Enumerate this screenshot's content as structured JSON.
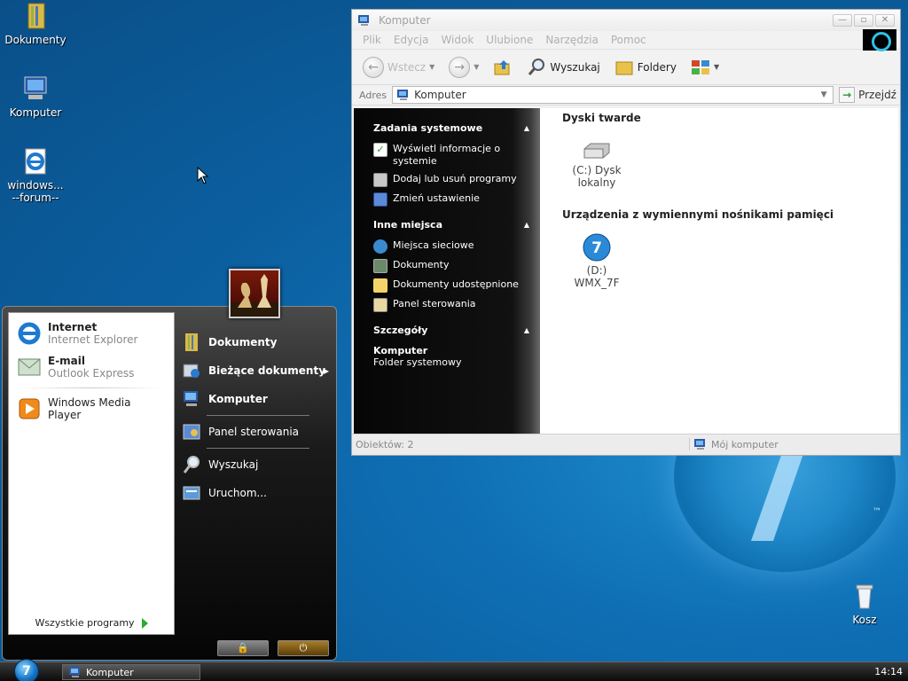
{
  "desktop": {
    "icons": [
      {
        "label": "Dokumenty"
      },
      {
        "label": "Komputer"
      },
      {
        "label": "windows...\n--forum--"
      },
      {
        "label": "Kosz"
      }
    ],
    "trademark": "™"
  },
  "window": {
    "title": "Komputer",
    "buttons": {
      "minimize": "—",
      "restore": "▫",
      "close": "✕"
    },
    "menu": [
      "Plik",
      "Edycja",
      "Widok",
      "Ulubione",
      "Narzędzia",
      "Pomoc"
    ],
    "toolbar": {
      "back": "Wstecz",
      "search": "Wyszukaj",
      "folders": "Foldery"
    },
    "address": {
      "label": "Adres",
      "value": "Komputer",
      "go": "Przejdź"
    },
    "taskpane": {
      "sections": [
        {
          "title": "Zadania systemowe",
          "items": [
            "Wyświetl informacje o systemie",
            "Dodaj lub usuń programy",
            "Zmień ustawienie"
          ]
        },
        {
          "title": "Inne miejsca",
          "items": [
            "Miejsca sieciowe",
            "Dokumenty",
            "Dokumenty udostępnione",
            "Panel sterowania"
          ]
        },
        {
          "title": "Szczegóły",
          "name": "Komputer",
          "type": "Folder systemowy"
        }
      ]
    },
    "groups": [
      {
        "title": "Dyski twarde",
        "items": [
          {
            "line1": "(C:) Dysk",
            "line2": "lokalny"
          }
        ]
      },
      {
        "title": "Urządzenia z wymiennymi nośnikami pamięci",
        "items": [
          {
            "line1": "(D:)",
            "line2": "WMX_7F",
            "badge": "7"
          }
        ]
      }
    ],
    "status": {
      "left": "Obiektów: 2",
      "right": "Mój komputer"
    }
  },
  "start_menu": {
    "pinned": [
      {
        "title": "Internet",
        "subtitle": "Internet Explorer"
      },
      {
        "title": "E-mail",
        "subtitle": "Outlook Express"
      }
    ],
    "recent": [
      "Windows Media Player"
    ],
    "all_programs": "Wszystkie programy",
    "right": [
      {
        "label": "Dokumenty",
        "bold": true
      },
      {
        "label": "Bieżące dokumenty",
        "bold": true,
        "submenu": true
      },
      {
        "label": "Komputer",
        "bold": true
      },
      {
        "label": "Panel sterowania"
      },
      {
        "label": "Wyszukaj"
      },
      {
        "label": "Uruchom..."
      }
    ]
  },
  "taskbar": {
    "orb": "7",
    "task": "Komputer",
    "clock": "14:14"
  }
}
